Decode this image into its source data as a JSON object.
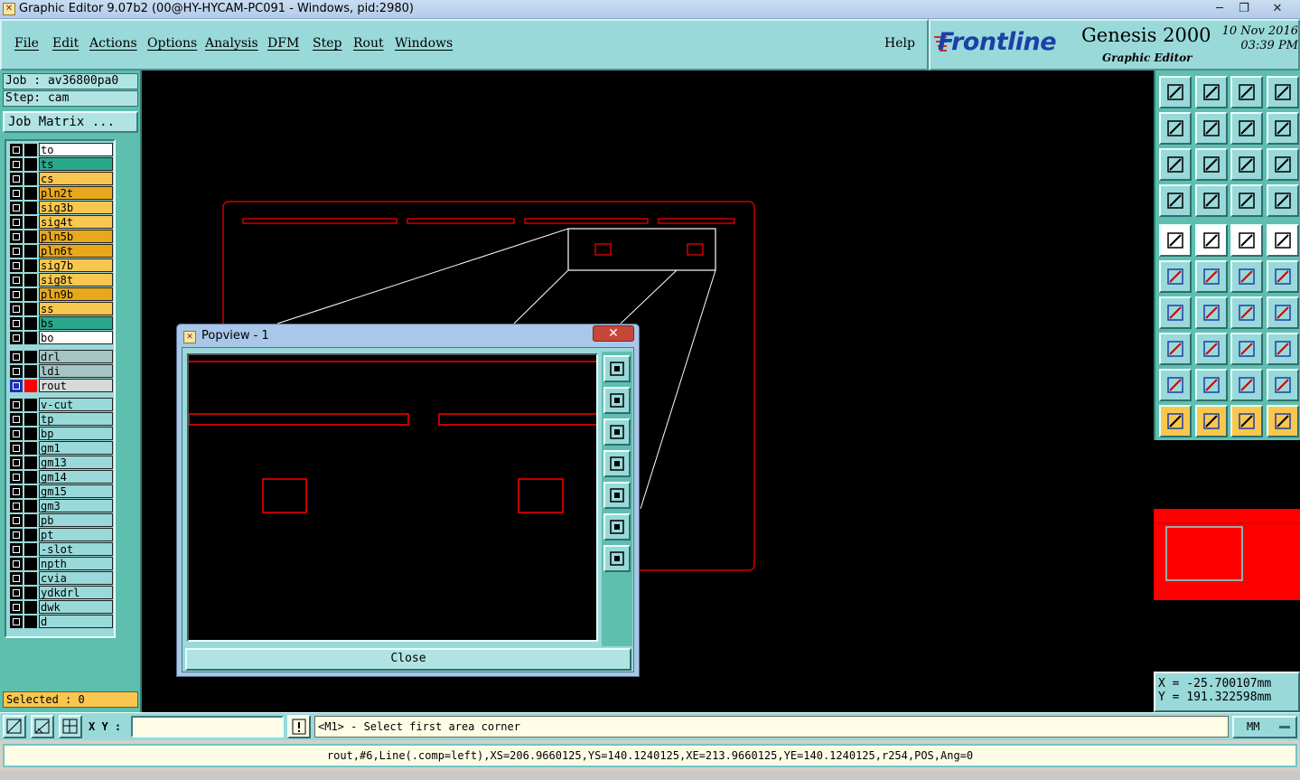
{
  "window": {
    "title": "Graphic Editor 9.07b2 (00@HY-HYCAM-PC091 - Windows, pid:2980)",
    "controls": [
      "─",
      "❐",
      "✕"
    ]
  },
  "menu": {
    "items": [
      "File",
      "Edit",
      "Actions",
      "Options",
      "Analysis",
      "DFM",
      "Step",
      "Rout",
      "Windows"
    ],
    "help": "Help"
  },
  "branding": {
    "logo": "Frontline",
    "product": "Genesis 2000",
    "subtitle": "Graphic Editor",
    "date": "10 Nov 2016",
    "time": "03:39 PM"
  },
  "job": {
    "job_label": "Job : av36800pa0",
    "step_label": "Step: cam",
    "matrix_button": "Job Matrix ..."
  },
  "layers": [
    {
      "name": "to",
      "color": "#ffffff"
    },
    {
      "name": "ts",
      "color": "#2aa88a"
    },
    {
      "name": "cs",
      "color": "#f9c74f"
    },
    {
      "name": "pln2t",
      "color": "#e8a81c"
    },
    {
      "name": "sig3b",
      "color": "#f9c74f"
    },
    {
      "name": "sig4t",
      "color": "#f9c74f"
    },
    {
      "name": "pln5b",
      "color": "#e8a81c"
    },
    {
      "name": "pln6t",
      "color": "#e8a81c"
    },
    {
      "name": "sig7b",
      "color": "#f9c74f"
    },
    {
      "name": "sig8t",
      "color": "#f9c74f"
    },
    {
      "name": "pln9b",
      "color": "#e8a81c"
    },
    {
      "name": "ss",
      "color": "#f9c74f"
    },
    {
      "name": "bs",
      "color": "#2aa88a"
    },
    {
      "name": "bo",
      "color": "#ffffff"
    },
    {
      "name": "drl",
      "color": "#a7c4c4"
    },
    {
      "name": "ldi",
      "color": "#a7c4c4"
    },
    {
      "name": "rout",
      "color": "#d9d9d9",
      "active": true
    },
    {
      "name": "v-cut",
      "color": "#99d9d9"
    },
    {
      "name": "tp",
      "color": "#99d9d9"
    },
    {
      "name": "bp",
      "color": "#99d9d9"
    },
    {
      "name": "gm1",
      "color": "#99d9d9"
    },
    {
      "name": "gm13",
      "color": "#99d9d9"
    },
    {
      "name": "gm14",
      "color": "#99d9d9"
    },
    {
      "name": "gm15",
      "color": "#99d9d9"
    },
    {
      "name": "gm3",
      "color": "#99d9d9"
    },
    {
      "name": "pb",
      "color": "#99d9d9"
    },
    {
      "name": "pt",
      "color": "#99d9d9"
    },
    {
      "name": "-slot",
      "color": "#99d9d9"
    },
    {
      "name": "npth",
      "color": "#99d9d9"
    },
    {
      "name": "cvia",
      "color": "#99d9d9"
    },
    {
      "name": "ydkdrl",
      "color": "#99d9d9"
    },
    {
      "name": "dwk",
      "color": "#99d9d9"
    },
    {
      "name": "d",
      "color": "#99d9d9"
    }
  ],
  "selected_label": "Selected : 0",
  "popview": {
    "title": "Popview - 1",
    "close_label": "Close"
  },
  "coords": {
    "x": "X = -25.700107mm",
    "y": "Y = 191.322598mm"
  },
  "bottom": {
    "xy_label": "X Y :",
    "xy_value": "",
    "prompt": "<M1> - Select first area corner",
    "units": "MM",
    "status": "rout,#6,Line(.comp=left),XS=206.9660125,YS=140.1240125,XE=213.9660125,YE=140.1240125,r254,POS,Ang=0"
  },
  "colors": {
    "panel": "#99d9d9",
    "panel_dark": "#5fbfae",
    "feature": "#ff0000",
    "canvas": "#000000"
  }
}
